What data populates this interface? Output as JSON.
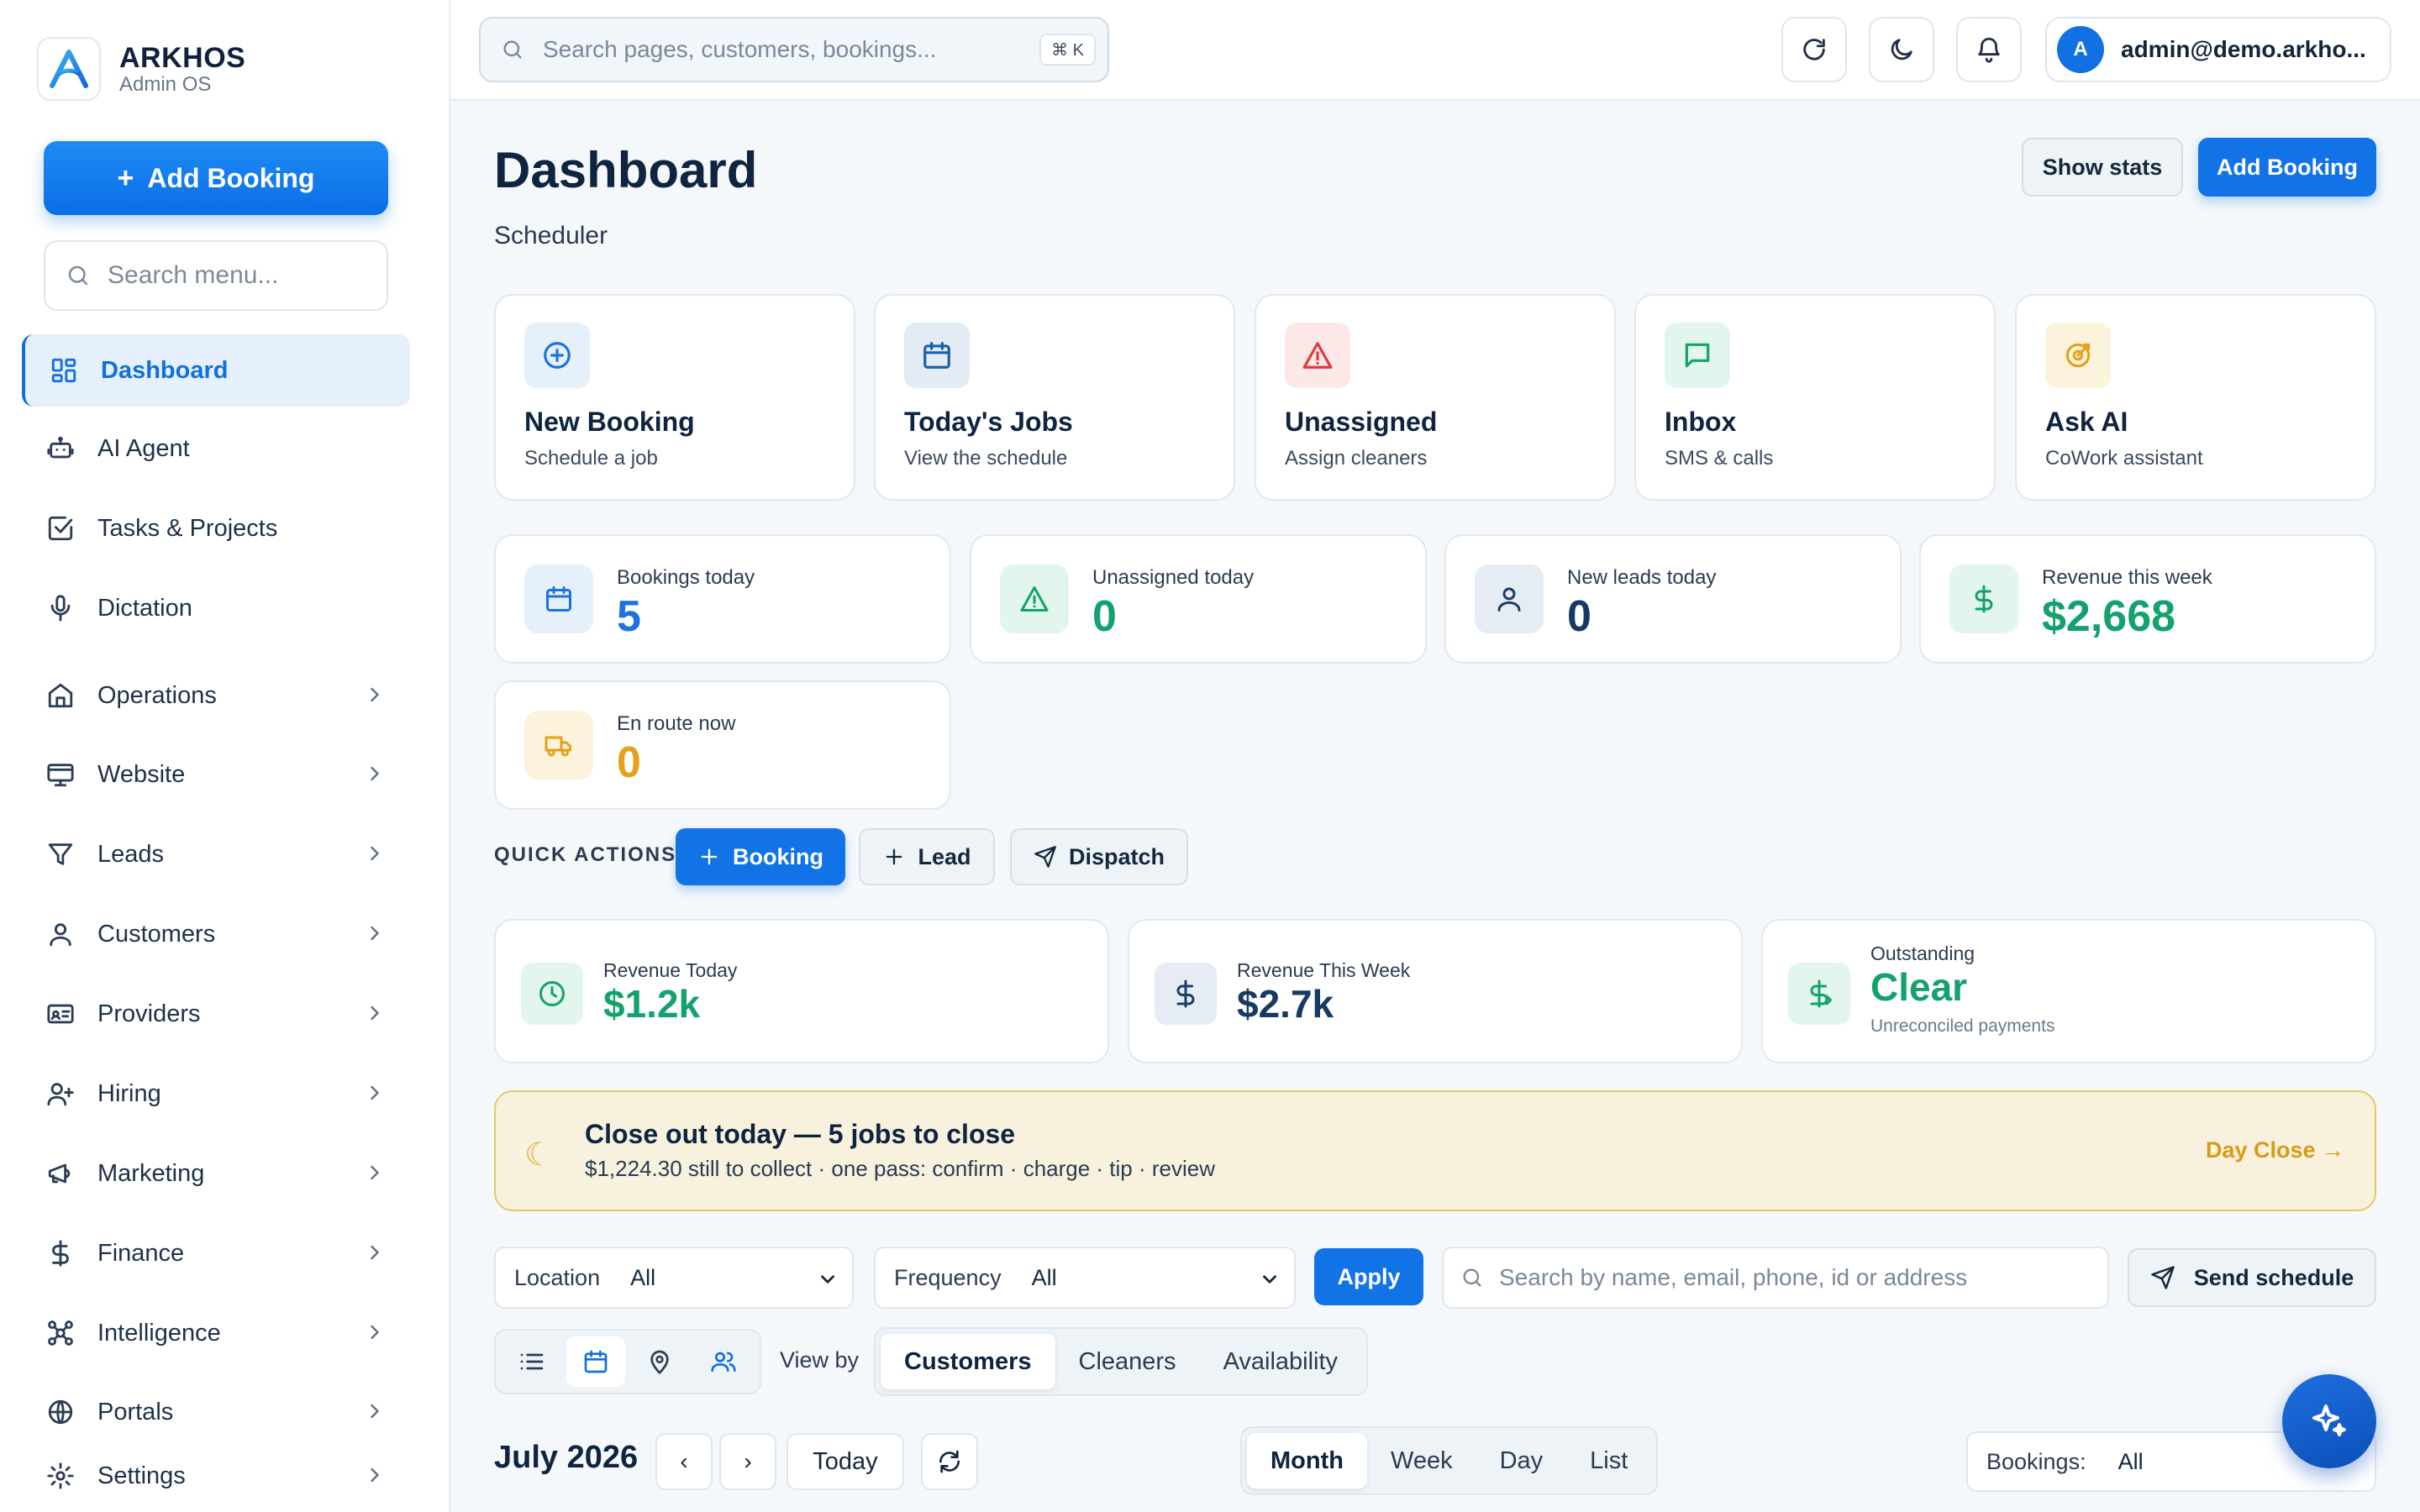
{
  "brand": {
    "name": "ARKHOS",
    "subtitle": "Admin OS"
  },
  "sidebar": {
    "add_booking_label": "Add Booking",
    "search_placeholder": "Search menu...",
    "items": [
      {
        "label": "Dashboard",
        "icon": "dashboard-grid-icon",
        "active": true
      },
      {
        "label": "AI Agent",
        "icon": "robot-icon"
      },
      {
        "label": "Tasks & Projects",
        "icon": "checkbox-icon"
      },
      {
        "label": "Dictation",
        "icon": "microphone-icon"
      },
      {
        "label": "Operations",
        "icon": "home-icon",
        "expandable": true
      },
      {
        "label": "Website",
        "icon": "monitor-icon",
        "expandable": true
      },
      {
        "label": "Leads",
        "icon": "funnel-icon",
        "expandable": true
      },
      {
        "label": "Customers",
        "icon": "user-icon",
        "expandable": true
      },
      {
        "label": "Providers",
        "icon": "id-card-icon",
        "expandable": true
      },
      {
        "label": "Hiring",
        "icon": "user-plus-icon",
        "expandable": true
      },
      {
        "label": "Marketing",
        "icon": "megaphone-icon",
        "expandable": true
      },
      {
        "label": "Finance",
        "icon": "dollar-icon",
        "expandable": true
      },
      {
        "label": "Intelligence",
        "icon": "nodes-icon",
        "expandable": true
      },
      {
        "label": "Portals",
        "icon": "globe-icon",
        "expandable": true
      },
      {
        "label": "Settings",
        "icon": "gear-icon",
        "expandable": true
      }
    ]
  },
  "topbar": {
    "search_placeholder": "Search pages, customers, bookings...",
    "shortcut": "⌘ K",
    "user_initial": "A",
    "user_email": "admin@demo.arkho..."
  },
  "header": {
    "title": "Dashboard",
    "subtitle": "Scheduler",
    "show_stats_label": "Show stats",
    "add_booking_label": "Add Booking"
  },
  "quick_cards": [
    {
      "title": "New Booking",
      "subtitle": "Schedule a job",
      "icon": "plus-circle-icon",
      "color": "#1a73e0",
      "bg": "#e6f0fb"
    },
    {
      "title": "Today's Jobs",
      "subtitle": "View the schedule",
      "icon": "calendar-icon",
      "color": "#1a5fa8",
      "bg": "#e3ecf5"
    },
    {
      "title": "Unassigned",
      "subtitle": "Assign cleaners",
      "icon": "warning-icon",
      "color": "#e0393e",
      "bg": "#fde8e8"
    },
    {
      "title": "Inbox",
      "subtitle": "SMS & calls",
      "icon": "chat-icon",
      "color": "#13a26b",
      "bg": "#e2f6ee"
    },
    {
      "title": "Ask AI",
      "subtitle": "CoWork assistant",
      "icon": "target-icon",
      "color": "#e3a21a",
      "bg": "#fcf3dd"
    }
  ],
  "stats": [
    {
      "label": "Bookings today",
      "value": "5",
      "icon": "calendar-icon",
      "color": "#1a73e0",
      "bg": "#e6f0fb"
    },
    {
      "label": "Unassigned today",
      "value": "0",
      "icon": "warning-icon",
      "color": "#13a26b",
      "bg": "#e2f6ee"
    },
    {
      "label": "New leads today",
      "value": "0",
      "icon": "user-icon",
      "color": "#1a3e66",
      "bg": "#e6ecf3"
    },
    {
      "label": "Revenue this week",
      "value": "$2,668",
      "icon": "dollar-icon",
      "color": "#13a26b",
      "bg": "#e2f6ee"
    },
    {
      "label": "En route now",
      "value": "0",
      "icon": "truck-icon",
      "color": "#e3a21a",
      "bg": "#fcf3dd"
    }
  ],
  "quick_actions": {
    "label": "QUICK ACTIONS",
    "buttons": [
      "Booking",
      "Lead",
      "Dispatch"
    ]
  },
  "revenue_cards": [
    {
      "label": "Revenue Today",
      "value": "$1.2k",
      "sub": "",
      "icon": "clock-icon",
      "color": "#13a26b",
      "bg": "#e2f6ee"
    },
    {
      "label": "Revenue This Week",
      "value": "$2.7k",
      "sub": "",
      "icon": "dollar-icon",
      "color": "#1a3e66",
      "bg": "#e6ecf3"
    },
    {
      "label": "Outstanding",
      "value": "Clear",
      "sub": "Unreconciled payments",
      "icon": "dollar-sign-icon",
      "color": "#13a26b",
      "bg": "#e2f6ee"
    }
  ],
  "closeout": {
    "title": "Close out today — 5 jobs to close",
    "subtitle": "$1,224.30 still to collect · one pass: confirm · charge · tip · review",
    "link": "Day Close →"
  },
  "filters": {
    "location_label": "Location",
    "location_value": "All",
    "frequency_label": "Frequency",
    "frequency_value": "All",
    "apply_label": "Apply",
    "search_placeholder": "Search by name, email, phone, id or address",
    "send_schedule_label": "Send schedule"
  },
  "view": {
    "view_by_label": "View by",
    "view_by_options": [
      "Customers",
      "Cleaners",
      "Availability"
    ],
    "range_options": [
      "Month",
      "Week",
      "Day",
      "List"
    ],
    "current_month": "July 2026",
    "prev": "‹",
    "next": "›",
    "today_label": "Today",
    "bookings_label": "Bookings:",
    "bookings_value": "All"
  }
}
